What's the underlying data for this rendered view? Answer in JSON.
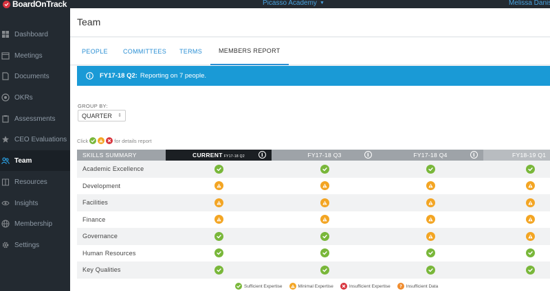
{
  "app": {
    "brand": "BoardOnTrack",
    "org": "Picasso Academy",
    "user": "Melissa Danisc"
  },
  "sidebar": {
    "items": [
      {
        "label": "Dashboard",
        "icon": "dashboard-icon",
        "active": false
      },
      {
        "label": "Meetings",
        "icon": "calendar-icon",
        "active": false
      },
      {
        "label": "Documents",
        "icon": "document-icon",
        "active": false
      },
      {
        "label": "OKRs",
        "icon": "target-icon",
        "active": false
      },
      {
        "label": "Assessments",
        "icon": "clipboard-icon",
        "active": false
      },
      {
        "label": "CEO Evaluations",
        "icon": "star-icon",
        "active": false
      },
      {
        "label": "Team",
        "icon": "team-icon",
        "active": true
      },
      {
        "label": "Resources",
        "icon": "book-icon",
        "active": false
      },
      {
        "label": "Insights",
        "icon": "eye-icon",
        "active": false
      },
      {
        "label": "Membership",
        "icon": "globe-icon",
        "active": false
      },
      {
        "label": "Settings",
        "icon": "gear-icon",
        "active": false
      }
    ]
  },
  "page": {
    "title": "Team"
  },
  "tabs": [
    {
      "label": "PEOPLE",
      "active": false
    },
    {
      "label": "COMMITTEES",
      "active": false
    },
    {
      "label": "TERMS",
      "active": false
    },
    {
      "label": "MEMBERS REPORT",
      "active": true
    }
  ],
  "banner": {
    "period": "FY17-18 Q2:",
    "text": "Reporting on 7 people."
  },
  "group_by": {
    "label": "GROUP BY:",
    "value": "QUARTER"
  },
  "hint": {
    "prefix": "Click",
    "suffix": "for details report"
  },
  "table": {
    "header": {
      "skills": "SKILLS SUMMARY",
      "current": "CURRENT",
      "current_sub": "FY17-18 Q2",
      "periods": [
        "FY17-18 Q3",
        "FY17-18 Q4",
        "FY18-19 Q1"
      ]
    },
    "rows": [
      {
        "skill": "Academic Excellence",
        "values": [
          "sufficient",
          "sufficient",
          "sufficient",
          "sufficient"
        ]
      },
      {
        "skill": "Development",
        "values": [
          "minimal",
          "minimal",
          "minimal",
          "minimal"
        ]
      },
      {
        "skill": "Facilities",
        "values": [
          "minimal",
          "minimal",
          "minimal",
          "minimal"
        ]
      },
      {
        "skill": "Finance",
        "values": [
          "minimal",
          "minimal",
          "minimal",
          "minimal"
        ]
      },
      {
        "skill": "Governance",
        "values": [
          "sufficient",
          "sufficient",
          "minimal",
          "minimal"
        ]
      },
      {
        "skill": "Human Resources",
        "values": [
          "sufficient",
          "sufficient",
          "sufficient",
          "sufficient"
        ]
      },
      {
        "skill": "Key Qualities",
        "values": [
          "sufficient",
          "sufficient",
          "sufficient",
          "sufficient"
        ]
      }
    ]
  },
  "legend": [
    {
      "label": "Sufficient Expertise",
      "status": "sufficient"
    },
    {
      "label": "Minimal Expertise",
      "status": "minimal"
    },
    {
      "label": "Insufficient Expertise",
      "status": "insufficient"
    },
    {
      "label": "Insufficient Data",
      "status": "nodata"
    }
  ],
  "colors": {
    "sidebar_bg": "#232a31",
    "accent": "#1a9ad6",
    "sufficient": "#79b73a",
    "minimal": "#f3a523",
    "insufficient": "#d8343d",
    "nodata": "#f08c2e"
  }
}
